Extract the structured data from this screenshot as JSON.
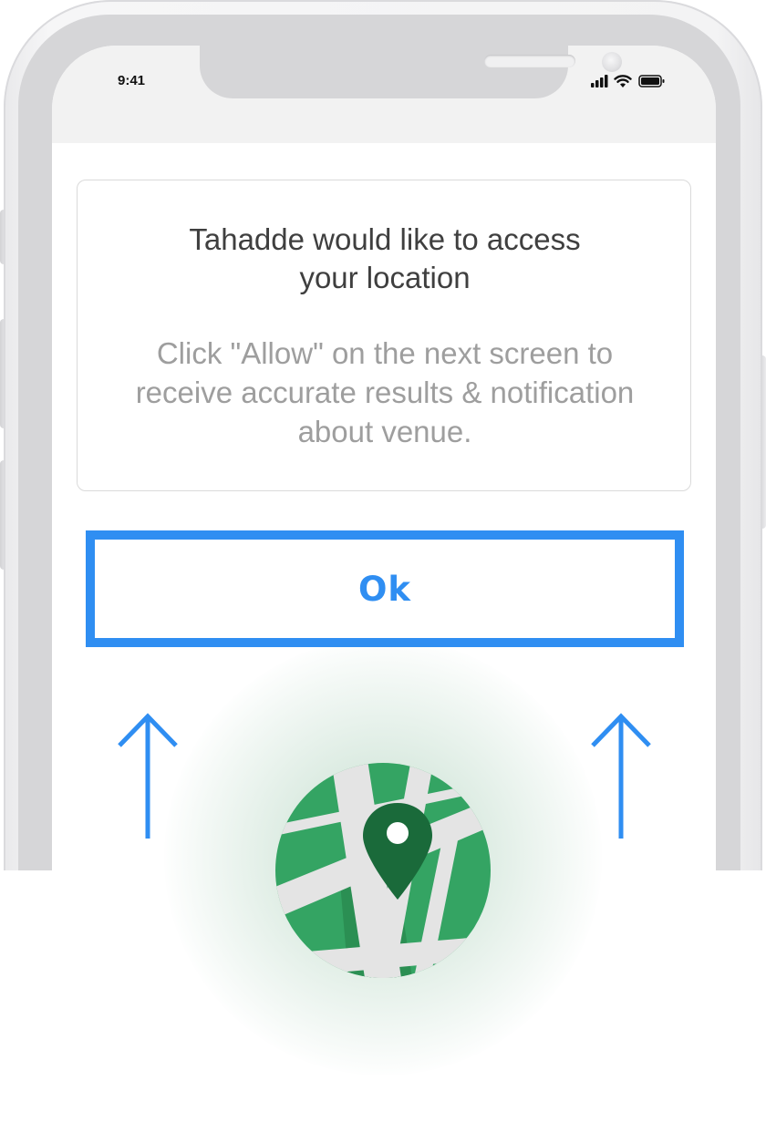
{
  "status_bar": {
    "time": "9:41",
    "icons": [
      "cellular-signal-icon",
      "wifi-icon",
      "battery-icon"
    ]
  },
  "permission_card": {
    "title": "Tahadde would like to access\nyour location",
    "description": "Click \"Allow\" on the next screen to\nreceive accurate results & notification\nabout venue."
  },
  "ok_button": {
    "label": "Ok"
  },
  "decorations": {
    "arrows": [
      "arrow-up-icon",
      "arrow-up-icon"
    ],
    "badge": "map-location-pin-icon"
  },
  "colors": {
    "accent": "#2f8ef2",
    "map_green": "#34a463",
    "pin_green": "#1a6a3a",
    "title_text": "#3f3f3f",
    "body_text": "#9e9e9e"
  }
}
